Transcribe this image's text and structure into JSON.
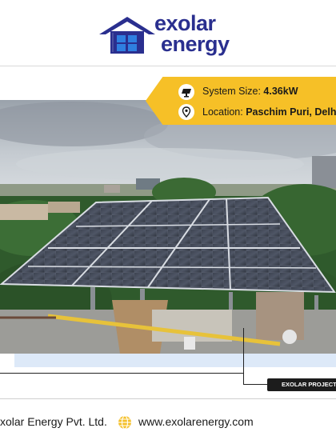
{
  "brand": {
    "line1": "exolar",
    "line2": "energy"
  },
  "project": {
    "size_label": "System Size:",
    "size_value": "4.36kW",
    "location_label": "Location:",
    "location_value": "Paschim Puri, Delhi"
  },
  "tag": "EXOLAR PROJECTS",
  "footer": {
    "company": "xolar Energy Pvt. Ltd.",
    "website": "www.exolarenergy.com"
  },
  "icons": [
    "house-window-logo-icon",
    "solar-panel-icon",
    "location-pin-icon",
    "globe-icon"
  ],
  "colors": {
    "brand_navy": "#2a2f8f",
    "accent_yellow": "#f6c027",
    "band_blue": "#dde9f8",
    "tag_bg": "#1c1c1c"
  }
}
